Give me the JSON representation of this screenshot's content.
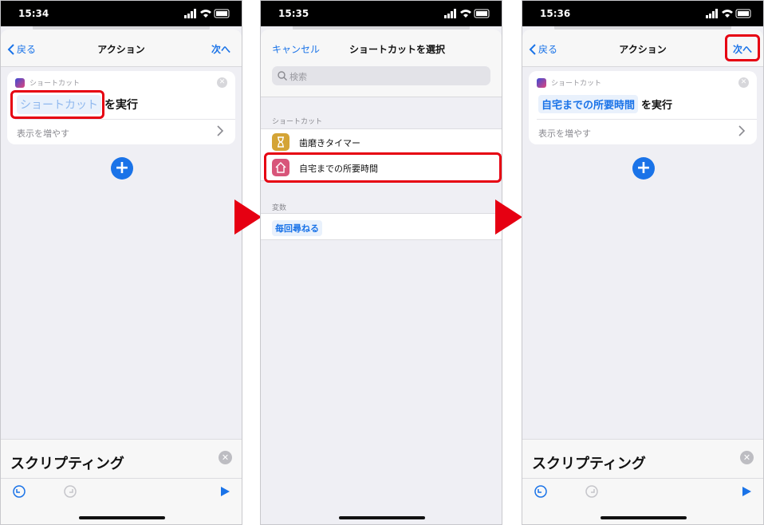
{
  "screen1": {
    "time": "15:34",
    "nav": {
      "back": "戻る",
      "title": "アクション",
      "next": "次へ"
    },
    "card": {
      "app_label": "ショートカット",
      "placeholder_token": "ショートカット",
      "suffix": "を実行",
      "show_more": "表示を増やす"
    },
    "bottom": {
      "title": "スクリプティング"
    }
  },
  "screen2": {
    "time": "15:35",
    "nav": {
      "cancel": "キャンセル",
      "title": "ショートカットを選択"
    },
    "search": {
      "placeholder": "検索"
    },
    "section_shortcuts": "ショートカット",
    "shortcuts": [
      {
        "label": "歯磨きタイマー",
        "icon": "hourglass-icon",
        "color": "#d4a436"
      },
      {
        "label": "自宅までの所要時間",
        "icon": "home-icon",
        "color": "#d8557a"
      }
    ],
    "section_variables": "変数",
    "variable_token": "毎回尋ねる"
  },
  "screen3": {
    "time": "15:36",
    "nav": {
      "back": "戻る",
      "title": "アクション",
      "next": "次へ"
    },
    "card": {
      "app_label": "ショートカット",
      "filled_token": "自宅までの所要時間",
      "suffix": "を実行",
      "show_more": "表示を増やす"
    },
    "bottom": {
      "title": "スクリプティング"
    }
  },
  "colors": {
    "accent": "#1a73e8",
    "highlight": "#e60012"
  }
}
